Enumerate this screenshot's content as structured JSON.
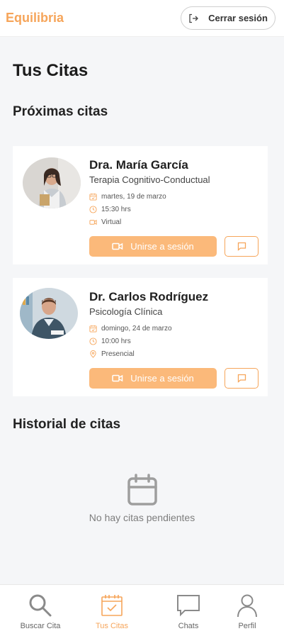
{
  "header": {
    "brand": "Equilibria",
    "logout_label": "Cerrar sesión"
  },
  "page": {
    "title": "Tus Citas"
  },
  "upcoming": {
    "title": "Próximas citas",
    "appointments": [
      {
        "name": "Dra. María García",
        "specialty": "Terapia Cognitivo-Conductual",
        "date": "martes, 19 de marzo",
        "time": "15:30 hrs",
        "mode": "Virtual",
        "mode_icon": "video-icon",
        "join_label": "Unirse a sesión"
      },
      {
        "name": "Dr. Carlos Rodríguez",
        "specialty": "Psicología Clínica",
        "date": "domingo, 24 de marzo",
        "time": "10:00 hrs",
        "mode": "Presencial",
        "mode_icon": "location-pin-icon",
        "join_label": "Unirse a sesión"
      }
    ]
  },
  "history": {
    "title": "Historial de citas",
    "empty_text": "No hay citas pendientes"
  },
  "nav": {
    "items": [
      {
        "label": "Buscar Cita",
        "icon": "search-icon"
      },
      {
        "label": "Tus Citas",
        "icon": "calendar-check-icon",
        "active": true
      },
      {
        "label": "Chats",
        "icon": "chat-icon"
      },
      {
        "label": "Perfil",
        "icon": "user-icon"
      }
    ]
  },
  "colors": {
    "accent": "#f6a55a",
    "button_fill": "#fbb97a",
    "background": "#f5f6f8"
  }
}
